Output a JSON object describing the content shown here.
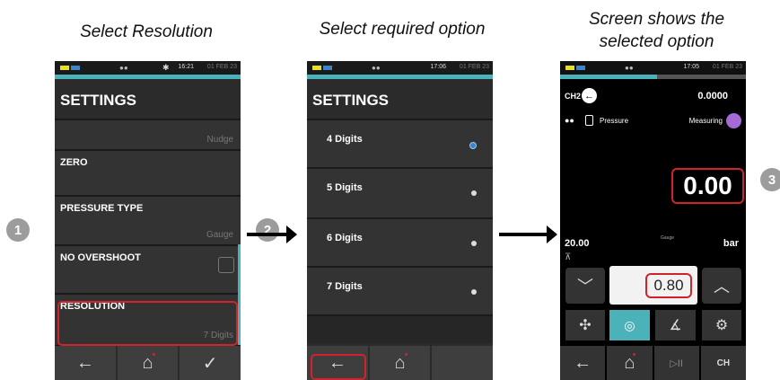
{
  "captions": {
    "c1": "Select Resolution",
    "c2": "Select required option",
    "c3_l1": "Screen shows the",
    "c3_l2": "selected option"
  },
  "steps": {
    "s1": "1",
    "s2": "2",
    "s3": "3"
  },
  "colors": {
    "accent_teal": "#4ab2b8",
    "highlight_red": "#d2232a",
    "mode_purple": "#a56ad6"
  },
  "screen1": {
    "status": {
      "time": "16:21",
      "date": "01 FEB 23"
    },
    "title": "SETTINGS",
    "rows": [
      {
        "label": "",
        "value": "Nudge"
      },
      {
        "label": "ZERO",
        "value": ""
      },
      {
        "label": "PRESSURE TYPE",
        "value": "Gauge"
      },
      {
        "label": "NO OVERSHOOT",
        "value": ""
      },
      {
        "label": "RESOLUTION",
        "value": "7 Digits"
      }
    ],
    "nav": {
      "back_icon": "←",
      "home_icon": "⌂",
      "confirm_icon": "✓"
    }
  },
  "screen2": {
    "status": {
      "time": "17:06",
      "date": "01 FEB 23"
    },
    "title": "SETTINGS",
    "options": [
      {
        "label": "4 Digits",
        "selected": true
      },
      {
        "label": "5 Digits",
        "selected": false
      },
      {
        "label": "6 Digits",
        "selected": false
      },
      {
        "label": "7 Digits",
        "selected": false
      }
    ],
    "nav": {
      "back_icon": "←",
      "home_icon": "⌂"
    }
  },
  "screen3": {
    "status": {
      "time": "17:05",
      "date": "01 FEB 23"
    },
    "channel": "CH2",
    "top_value": "0.0000",
    "function": "Pressure",
    "mode": "Measuring",
    "main_value": "0.00",
    "range_value": "20.00",
    "pressure_type": "Gauge",
    "unit": "bar",
    "setpoint": "0.80",
    "nav": {
      "back_icon": "←",
      "home_icon": "⌂",
      "play_pause": "▷II",
      "channel_icon": "CH"
    }
  }
}
